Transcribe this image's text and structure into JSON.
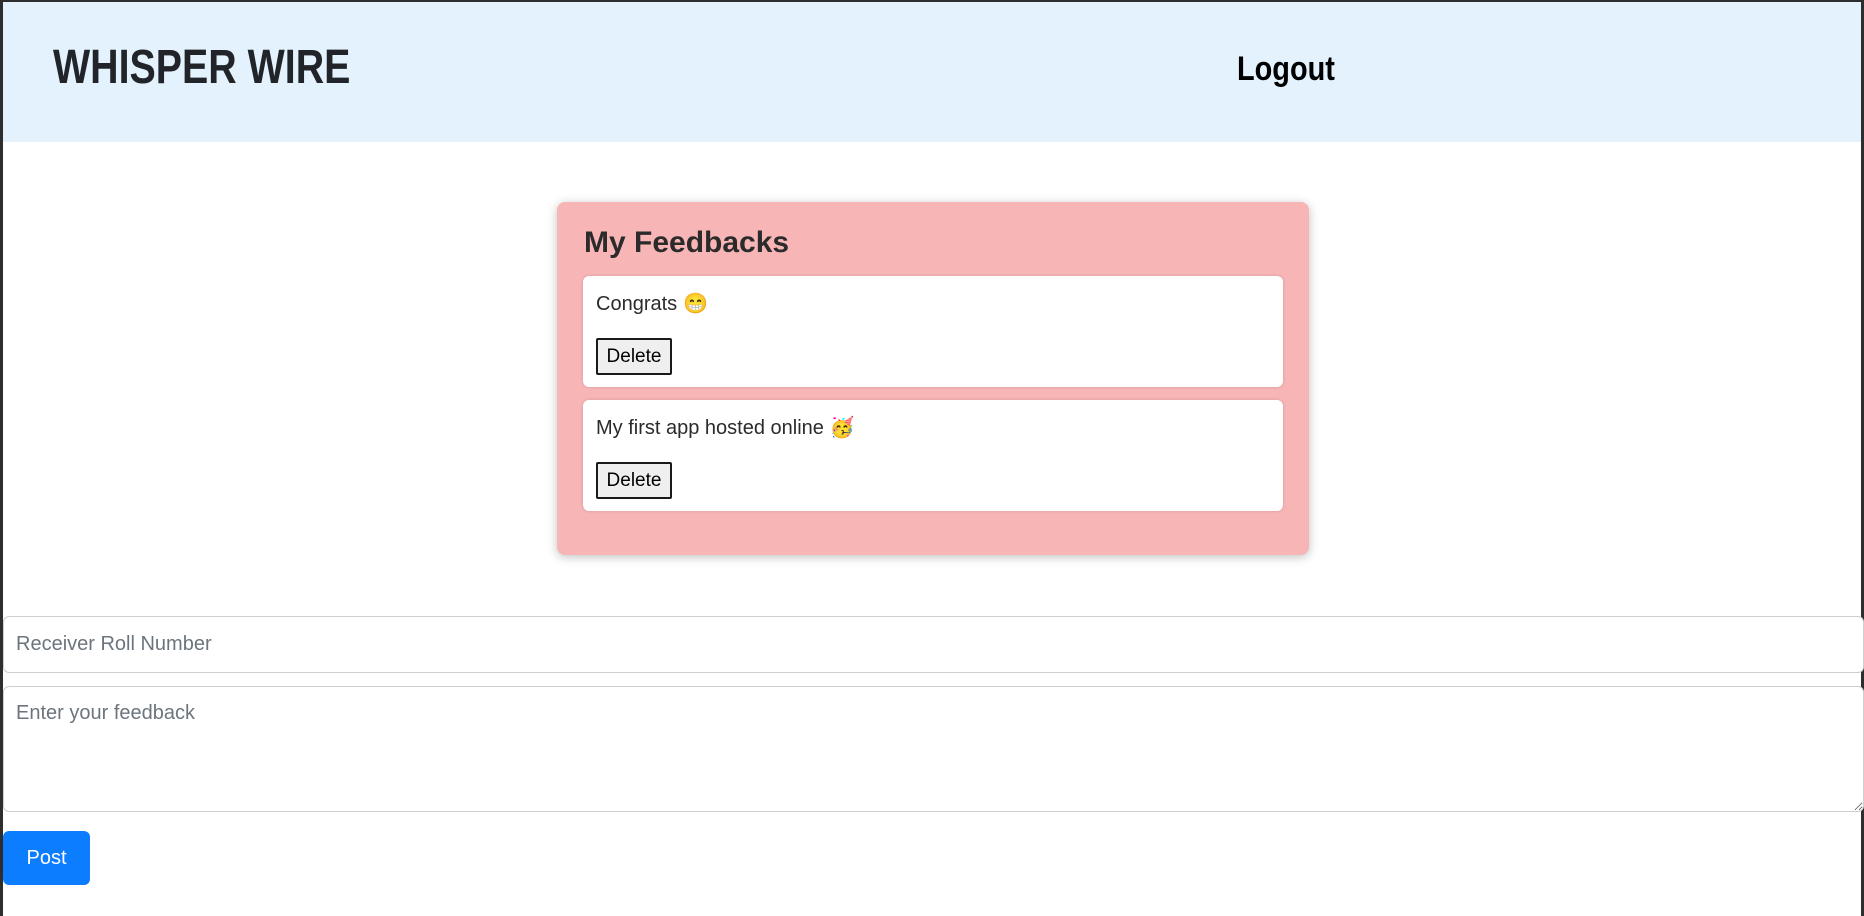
{
  "navbar": {
    "brand": "WHISPER WIRE",
    "logout_label": "Logout",
    "background": "#e3f2fd"
  },
  "feedbacks": {
    "title": "My Feedbacks",
    "background": "#f7b5b6",
    "items": [
      {
        "text": "Congrats",
        "emoji": "😁",
        "delete_label": "Delete"
      },
      {
        "text": "My first app hosted online",
        "emoji": "🥳",
        "delete_label": "Delete"
      }
    ]
  },
  "form": {
    "roll_placeholder": "Receiver Roll Number",
    "feedback_placeholder": "Enter your feedback",
    "post_label": "Post",
    "post_color": "#0b7dfe"
  }
}
